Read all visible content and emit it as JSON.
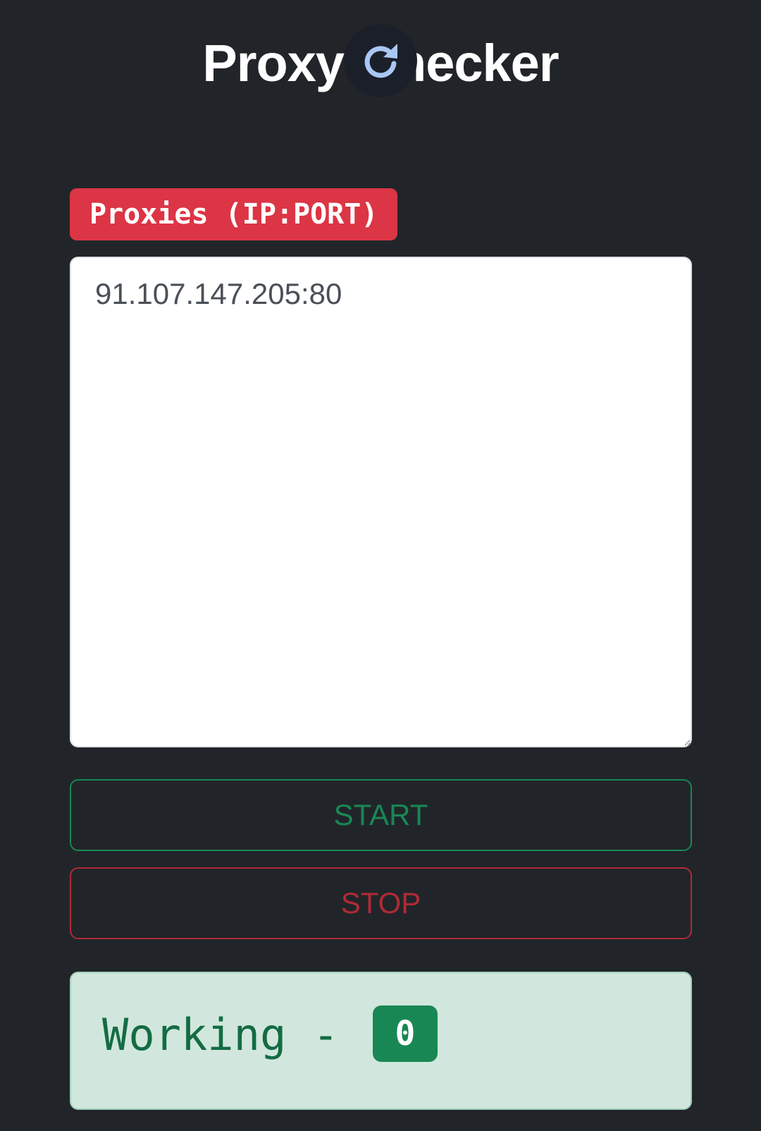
{
  "header": {
    "title": "Proxy Checker",
    "refresh_icon": "refresh-icon",
    "refresh_icon_color": "#a9c7f5"
  },
  "proxies": {
    "label": "Proxies (IP:PORT)",
    "value": "91.107.147.205:80"
  },
  "controls": {
    "start_label": "START",
    "stop_label": "STOP"
  },
  "status": {
    "label": "Working - ",
    "count": "0"
  },
  "colors": {
    "background": "#212529",
    "label_bg": "#dc3545",
    "start": "#198754",
    "stop": "#b02a37",
    "status_bg": "#d1e7dd"
  }
}
